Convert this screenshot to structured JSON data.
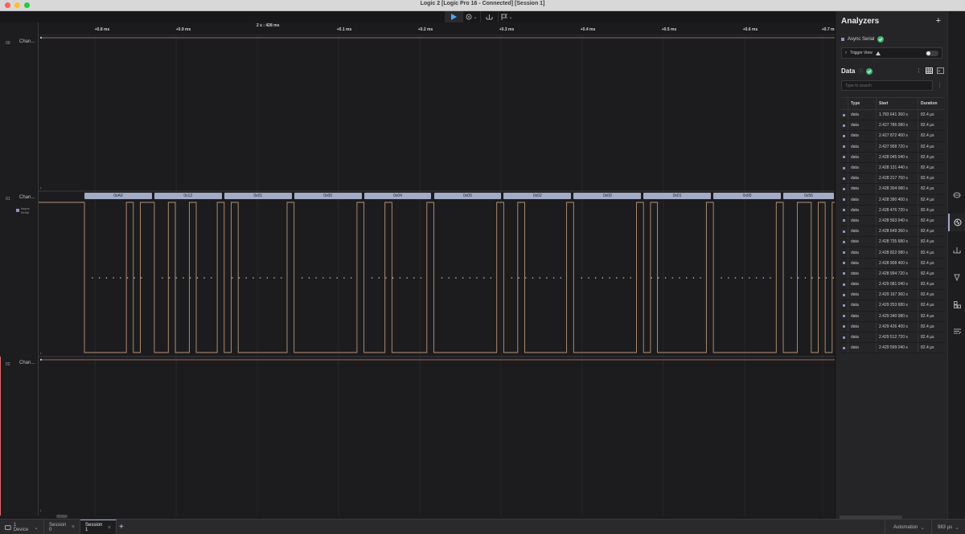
{
  "window": {
    "title": "Logic 2 [Logic Pro 16 - Connected] [Session 1]"
  },
  "toolbar": {
    "run_icon": "play-icon",
    "caret": "⌄"
  },
  "ruler": {
    "center_label": "2 s : 428 ms",
    "ticks": [
      "+0.8 ms",
      "+0.9 ms",
      "+0.1 ms",
      "+0.2 ms",
      "+0.3 ms",
      "+0.4 ms",
      "+0.5 ms",
      "+0.6 ms",
      "+0.7 ms"
    ]
  },
  "channels": [
    {
      "num": "00",
      "name": "Chan...",
      "color": "#e06a6a"
    },
    {
      "num": "01",
      "name": "Chan...",
      "color": "#e0a46a",
      "analyzer": "Async Serial"
    },
    {
      "num": "02",
      "name": "Chan...",
      "color": "#e06a6a"
    }
  ],
  "decoded_bytes": [
    "0xA0",
    "0x12",
    "0x01",
    "0x00",
    "0x04",
    "0x00",
    "0x02",
    "0x00",
    "0x01",
    "0x00",
    "0x56"
  ],
  "analyzers": {
    "title": "Analyzers",
    "add": "+",
    "items": [
      {
        "name": "Async Serial"
      }
    ],
    "trigger_view": "Trigger View",
    "data_title": "Data",
    "data_info": "ⓘ",
    "search_placeholder": "Type to search",
    "table": {
      "headers": [
        "Type",
        "Start",
        "Duration"
      ],
      "rows": [
        [
          "data",
          "1.783 641 360 s",
          "82.4 µs"
        ],
        [
          "data",
          "2.427 786 080 s",
          "82.4 µs"
        ],
        [
          "data",
          "2.427 872 400 s",
          "82.4 µs"
        ],
        [
          "data",
          "2.427 958 720 s",
          "82.4 µs"
        ],
        [
          "data",
          "2.428 045 040 s",
          "82.4 µs"
        ],
        [
          "data",
          "2.428 131 440 s",
          "82.4 µs"
        ],
        [
          "data",
          "2.428 217 760 s",
          "82.4 µs"
        ],
        [
          "data",
          "2.428 304 080 s",
          "82.4 µs"
        ],
        [
          "data",
          "2.428 390 400 s",
          "82.4 µs"
        ],
        [
          "data",
          "2.428 476 720 s",
          "82.4 µs"
        ],
        [
          "data",
          "2.428 563 040 s",
          "82.4 µs"
        ],
        [
          "data",
          "2.428 649 360 s",
          "82.4 µs"
        ],
        [
          "data",
          "2.428 735 680 s",
          "82.4 µs"
        ],
        [
          "data",
          "2.428 822 080 s",
          "82.4 µs"
        ],
        [
          "data",
          "2.428 908 400 s",
          "82.4 µs"
        ],
        [
          "data",
          "2.428 994 720 s",
          "82.4 µs"
        ],
        [
          "data",
          "2.429 081 040 s",
          "82.4 µs"
        ],
        [
          "data",
          "2.429 167 360 s",
          "82.4 µs"
        ],
        [
          "data",
          "2.429 253 680 s",
          "82.4 µs"
        ],
        [
          "data",
          "2.429 340 080 s",
          "82.4 µs"
        ],
        [
          "data",
          "2.429 426 400 s",
          "82.4 µs"
        ],
        [
          "data",
          "2.429 512 720 s",
          "82.4 µs"
        ],
        [
          "data",
          "2.429 599 040 s",
          "82.4 µs"
        ]
      ]
    }
  },
  "bottombar": {
    "device": "1 Device",
    "tabs": [
      {
        "label": "Session 0"
      },
      {
        "label": "Session 1"
      }
    ],
    "add_tab": "+",
    "mode": "Automation",
    "timespan": "983 µs"
  },
  "colors": {
    "accent": "#9ea6c9",
    "bubble": "#a3abc6",
    "signal": "#cc9a73",
    "success": "#3cb371"
  }
}
